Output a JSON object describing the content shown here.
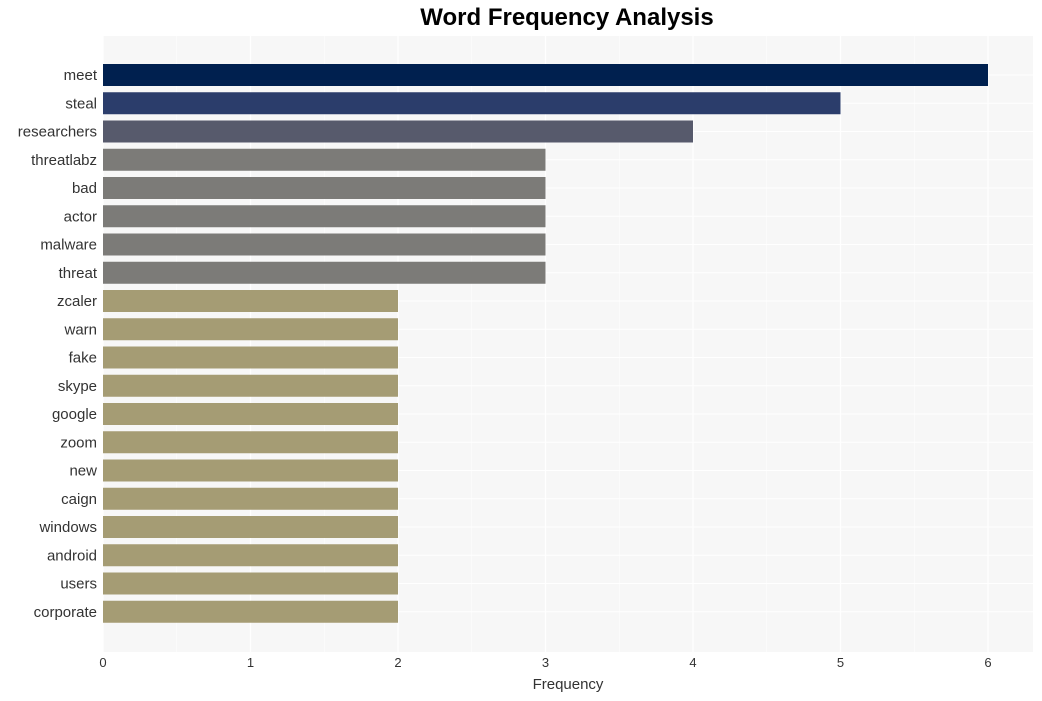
{
  "chart_data": {
    "type": "bar",
    "orientation": "horizontal",
    "title": "Word Frequency Analysis",
    "xlabel": "Frequency",
    "ylabel": "",
    "xlim": [
      0,
      6.3
    ],
    "xticks": [
      0,
      1,
      2,
      3,
      4,
      5,
      6
    ],
    "grid": true,
    "categories": [
      "meet",
      "steal",
      "researchers",
      "threatlabz",
      "bad",
      "actor",
      "malware",
      "threat",
      "zcaler",
      "warn",
      "fake",
      "skype",
      "google",
      "zoom",
      "new",
      "caign",
      "windows",
      "android",
      "users",
      "corporate"
    ],
    "values": [
      6,
      5,
      4,
      3,
      3,
      3,
      3,
      3,
      2,
      2,
      2,
      2,
      2,
      2,
      2,
      2,
      2,
      2,
      2,
      2
    ],
    "colors": [
      "#00204f",
      "#2b3d6b",
      "#575a6c",
      "#7c7b78",
      "#7c7b78",
      "#7c7b78",
      "#7c7b78",
      "#7c7b78",
      "#a59c74",
      "#a59c74",
      "#a59c74",
      "#a59c74",
      "#a59c74",
      "#a59c74",
      "#a59c74",
      "#a59c74",
      "#a59c74",
      "#a59c74",
      "#a59c74",
      "#a59c74"
    ]
  }
}
